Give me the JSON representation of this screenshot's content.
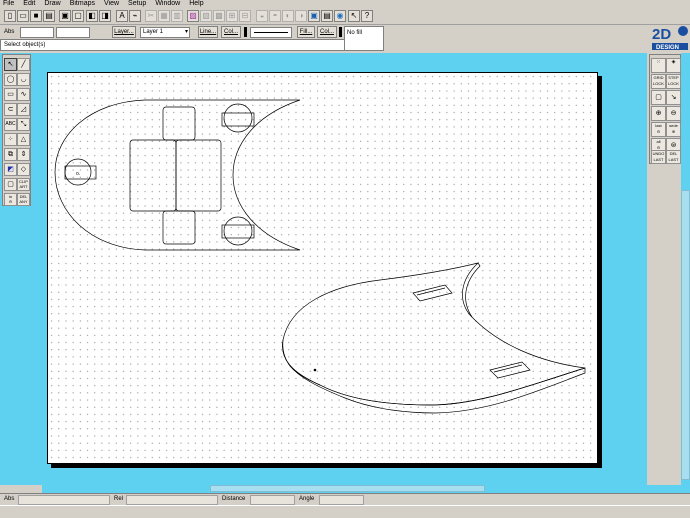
{
  "menu": [
    "File",
    "Edit",
    "Draw",
    "Bitmaps",
    "View",
    "Setup",
    "Window",
    "Help"
  ],
  "toolbar": {
    "icons": [
      "new-icon",
      "open-icon",
      "save-icon",
      "print-icon",
      "copy-page-icon",
      "paste-page-icon",
      "cut-icon",
      "copy-icon",
      "paste-icon",
      "delete-icon",
      "text-icon",
      "text-edit-icon",
      "group-icon",
      "ungroup-icon",
      "align-icon",
      "arrange-icon",
      "mirror-icon",
      "rotate-icon",
      "fill-icon",
      "shade-icon",
      "layer-icon",
      "print-preview-icon",
      "view-icon",
      "help-cursor-icon",
      "help-icon"
    ]
  },
  "props": {
    "abs_label": "Abs",
    "layer_button": "Layer...",
    "layer_value": "Layer 1",
    "line_button": "Line...",
    "col_button": "Col...",
    "fill_button": "Fill...",
    "col2_button": "Col...",
    "fill_value": "No fill",
    "status_prompt": "Select object(s)"
  },
  "brand": {
    "text": "2D",
    "subtext": "DESIGN",
    "color": "#1a4fa0"
  },
  "left_tools": {
    "abc": "ABC",
    "clip": "CLIP",
    "art": "ART",
    "in": "in",
    "del": "DEL",
    "any": "ANY"
  },
  "right_tools": {
    "grid": "GRID",
    "lock": "LOCK",
    "step": "STEP",
    "lock2": "LOCK",
    "last": "last",
    "sede": "sede",
    "all": "all",
    "undo": "UNDO",
    "last2": "LAST",
    "del": "DEL",
    "last3": "LAST"
  },
  "drawing": {
    "hole_label": "o."
  },
  "status": {
    "abs": "Abs",
    "rel": "Rel",
    "distance": "Distance",
    "angle": "Angle"
  },
  "colors": {
    "workspace": "#5ed1f0",
    "paper": "#ffffff",
    "chrome": "#d4d0c8"
  }
}
